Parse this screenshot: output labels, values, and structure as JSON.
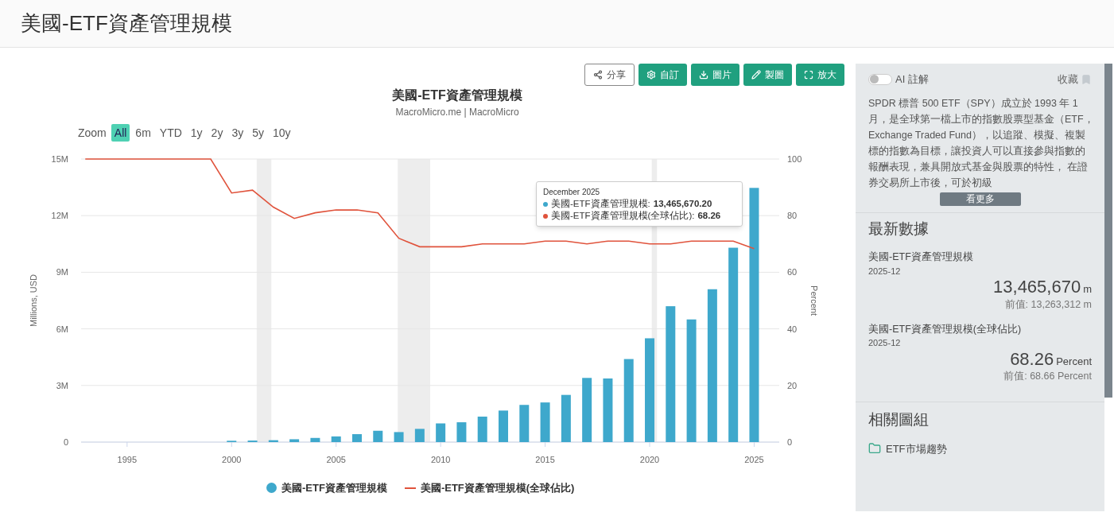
{
  "page_title": "美國-ETF資產管理規模",
  "toolbar": [
    {
      "label": "分享",
      "kind": "share"
    },
    {
      "label": "自訂",
      "kind": "settings"
    },
    {
      "label": "圖片",
      "kind": "download"
    },
    {
      "label": "製圖",
      "kind": "edit"
    },
    {
      "label": "放大",
      "kind": "expand"
    }
  ],
  "chart": {
    "title": "美國-ETF資產管理規模",
    "subtitle": "MacroMicro.me | MacroMicro",
    "zoom_label": "Zoom",
    "zoom_options": [
      {
        "label": "All",
        "selected": true
      },
      {
        "label": "6m",
        "selected": false
      },
      {
        "label": "YTD",
        "selected": false
      },
      {
        "label": "1y",
        "selected": false
      },
      {
        "label": "2y",
        "selected": false
      },
      {
        "label": "3y",
        "selected": false
      },
      {
        "label": "5y",
        "selected": false
      },
      {
        "label": "10y",
        "selected": false
      }
    ],
    "tooltip": {
      "title": "December 2025",
      "rows": [
        {
          "label": "美國-ETF資產管理規模: ",
          "value": "13,465,670.20",
          "color": "#3ea8cc"
        },
        {
          "label": "美國-ETF資產管理規模(全球佔比): ",
          "value": "68.26",
          "color": "#e0533c"
        }
      ]
    },
    "layers": [
      {
        "chart_data": {
          "type": "bar",
          "ylabel": "Millions, USD",
          "grid": true,
          "x": [
            2000,
            2001,
            2002,
            2003,
            2004,
            2005,
            2006,
            2007,
            2008,
            2009,
            2010,
            2011,
            2012,
            2013,
            2014,
            2015,
            2016,
            2017,
            2018,
            2019,
            2020,
            2021,
            2022,
            2023,
            2024,
            2025
          ],
          "series": [
            {
              "name": "美國-ETF資產管理規模",
              "color": "#3ea8cc",
              "values": [
                0.07,
                0.08,
                0.1,
                0.15,
                0.22,
                0.3,
                0.42,
                0.6,
                0.53,
                0.7,
                0.99,
                1.05,
                1.35,
                1.67,
                1.97,
                2.1,
                2.5,
                3.4,
                3.37,
                4.4,
                5.5,
                7.2,
                6.5,
                8.1,
                10.3,
                13.47
              ]
            }
          ],
          "xlim": [
            1992.8,
            2026.2
          ],
          "ylim": [
            0,
            15
          ],
          "xticks": [
            1995,
            2000,
            2005,
            2010,
            2015,
            2020,
            2025
          ],
          "yticks": [
            {
              "value": 0,
              "label": "0"
            },
            {
              "value": 3,
              "label": "3M"
            },
            {
              "value": 6,
              "label": "6M"
            },
            {
              "value": 9,
              "label": "9M"
            },
            {
              "value": 12,
              "label": "12M"
            },
            {
              "value": 15,
              "label": "15M"
            }
          ]
        }
      },
      {
        "chart_data": {
          "type": "line",
          "ylabel": "Percent",
          "x": [
            1993,
            1994,
            1995,
            1996,
            1997,
            1998,
            1999,
            2000,
            2001,
            2002,
            2003,
            2004,
            2005,
            2006,
            2007,
            2008,
            2009,
            2010,
            2011,
            2012,
            2013,
            2014,
            2015,
            2016,
            2017,
            2018,
            2019,
            2020,
            2021,
            2022,
            2023,
            2024,
            2025
          ],
          "series": [
            {
              "name": "美國-ETF資產管理規模(全球佔比)",
              "color": "#e0533c",
              "values": [
                100,
                100,
                100,
                100,
                100,
                100,
                100,
                88,
                89,
                83,
                79,
                81,
                82,
                82,
                81,
                72,
                69,
                69,
                69,
                70,
                70,
                70,
                71,
                71,
                70,
                71,
                71,
                70,
                70,
                71,
                71,
                71,
                68.3
              ]
            }
          ],
          "xlim": [
            1992.8,
            2026.2
          ],
          "ylim": [
            0,
            100
          ],
          "yticks": [
            0,
            20,
            40,
            60,
            80,
            100
          ]
        }
      }
    ]
  },
  "sidebar": {
    "ai_toggle": {
      "label": "AI 註解",
      "on": false
    },
    "bookmark_label": "收藏",
    "description": "SPDR 標普 500 ETF（SPY）成立於 1993 年 1 月，是全球第一檔上市的指數股票型基金（ETF，Exchange Traded Fund），以追蹤、模擬、複製標的指數為目標，讓投資人可以直接參與指數的報酬表現，兼具開放式基金與股票的特性， 在證券交易所上市後，可於初級",
    "more_button": "看更多",
    "latest_title": "最新數據",
    "latest": [
      {
        "name": "美國-ETF資產管理規模",
        "date": "2025-12",
        "value": "13,465,670",
        "unit": "m",
        "previous": "前值: 13,263,312 m"
      },
      {
        "name": "美國-ETF資產管理規模(全球佔比)",
        "date": "2025-12",
        "value": "68.26",
        "unit": "Percent",
        "previous": "前值: 68.66 Percent"
      }
    ],
    "related_title": "相關圖組",
    "related": [
      {
        "label": "ETF市場趨勢"
      }
    ]
  }
}
